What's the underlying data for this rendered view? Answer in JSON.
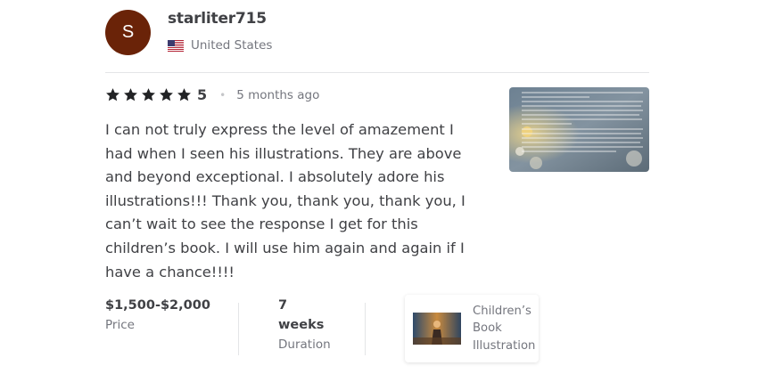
{
  "reviewer": {
    "avatar_initial": "S",
    "avatar_color": "#6a2308",
    "username": "starliter715",
    "country": "United States",
    "country_flag_icon": "us-flag-icon"
  },
  "review": {
    "stars": 5,
    "star_icon": "star-icon",
    "star_color": "#222325",
    "rating": "5",
    "separator": "•",
    "time_ago": "5 months ago",
    "text": "I can not truly express the level of amazement I had when I seen his illustrations. They are above and beyond exceptional. I absolutely adore his illustrations!!! Thank you, thank you, thank you, I can’t wait to see the response I get for this children’s book. I will use him again and again if I have a chance!!!!"
  },
  "stats": {
    "price_value": "$1,500-$2,000",
    "price_label": "Price",
    "duration_value_line1": "7",
    "duration_value_line2": "weeks",
    "duration_label": "Duration"
  },
  "service": {
    "name": "Children’s Book Illustration"
  }
}
